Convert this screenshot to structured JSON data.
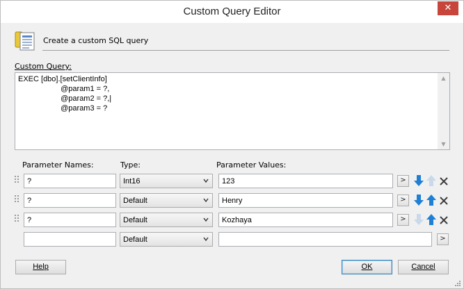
{
  "window": {
    "title": "Custom Query Editor",
    "close_glyph": "✕"
  },
  "header": {
    "text": "Create a custom SQL query",
    "icon": "database-script-icon"
  },
  "query": {
    "label": "Custom Query:",
    "text": "EXEC [dbo].[setClientInfo]\n                    @param1 = ?,\n                    @param2 = ?,|\n                    @param3 = ?"
  },
  "columns": {
    "names": "Parameter Names:",
    "type": "Type:",
    "values": "Parameter Values:"
  },
  "parameters": [
    {
      "name": "?",
      "type": "Int16",
      "value": "123",
      "more": ">",
      "up_enabled": false,
      "down_enabled": true,
      "delete": true
    },
    {
      "name": "?",
      "type": "Default",
      "value": "Henry",
      "more": ">",
      "up_enabled": true,
      "down_enabled": true,
      "delete": true
    },
    {
      "name": "?",
      "type": "Default",
      "value": "Kozhaya",
      "more": ">",
      "up_enabled": true,
      "down_enabled": false,
      "delete": true
    },
    {
      "name": "",
      "type": "Default",
      "value": "",
      "more": ">"
    }
  ],
  "buttons": {
    "help": "Help",
    "ok": "OK",
    "cancel": "Cancel"
  },
  "colors": {
    "close": "#c7453b",
    "arrow_enabled": "#1e7fd4",
    "arrow_disabled": "#c9d9ea",
    "default_button_border": "#3c7fb1"
  }
}
